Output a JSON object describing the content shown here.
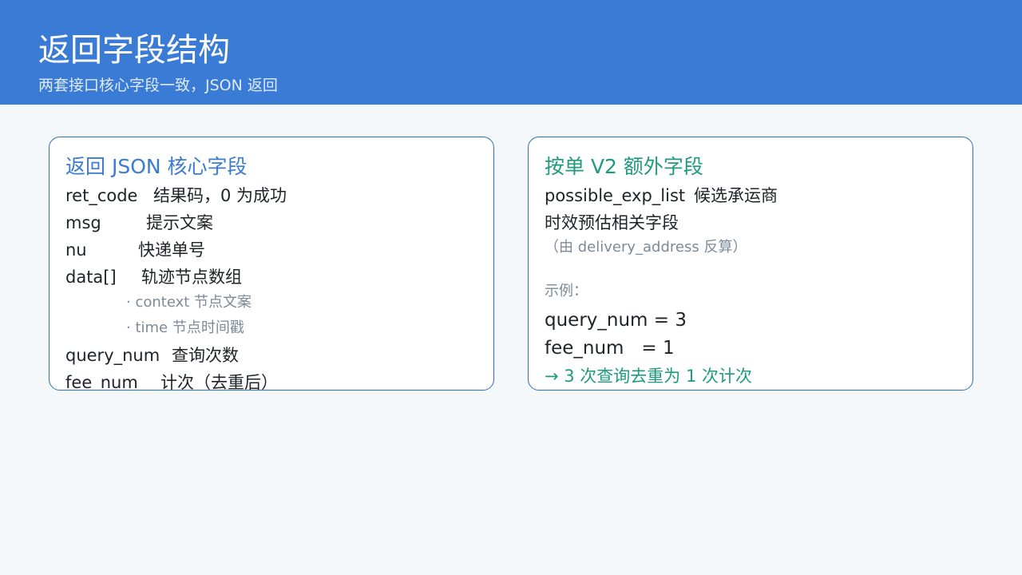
{
  "header": {
    "title": "返回字段结构",
    "subtitle": "两套接口核心字段一致，JSON 返回"
  },
  "left_card": {
    "title": "返回 JSON 核心字段",
    "rows": [
      {
        "key": "ret_code",
        "desc": "结果码，0 为成功"
      },
      {
        "key": "msg",
        "desc": "提示文案"
      },
      {
        "key": "nu",
        "desc": "快递单号"
      },
      {
        "key": "data[]",
        "desc": "轨迹节点数组"
      }
    ],
    "sub_rows": [
      "· context 节点文案",
      "· time  节点时间戳"
    ],
    "rows2": [
      {
        "key": "query_num",
        "desc": "查询次数"
      },
      {
        "key": "fee_num",
        "desc": "计次（去重后）"
      }
    ]
  },
  "right_card": {
    "title": "按单 V2 额外字段",
    "line1_key": "possible_exp_list",
    "line1_desc": "候选承运商",
    "line2": "时效预估相关字段",
    "line3": "（由 delivery_address 反算）",
    "example_label": "示例：",
    "example1": "query_num = 3",
    "example2": "fee_num   = 1",
    "result": "→ 3 次查询去重为 1 次计次"
  },
  "colors": {
    "header_bg": "#3a7bd5",
    "accent_blue": "#3a7bd5",
    "accent_teal": "#1f9a7e",
    "card_border": "#2f6fb6"
  }
}
